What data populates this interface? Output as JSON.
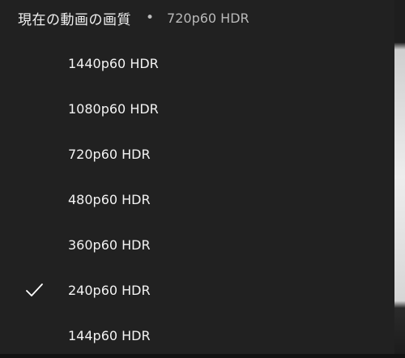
{
  "header": {
    "title": "現在の動画の画質",
    "separator": "•",
    "current_quality": "720p60 HDR"
  },
  "quality_options": [
    {
      "label": "1440p60 HDR",
      "selected": false
    },
    {
      "label": "1080p60 HDR",
      "selected": false
    },
    {
      "label": "720p60 HDR",
      "selected": false
    },
    {
      "label": "480p60 HDR",
      "selected": false
    },
    {
      "label": "360p60 HDR",
      "selected": false
    },
    {
      "label": "240p60 HDR",
      "selected": true
    },
    {
      "label": "144p60 HDR",
      "selected": false
    }
  ],
  "icons": {
    "selected": "check-icon"
  },
  "colors": {
    "menu_background": "#212121",
    "text": "#ffffff",
    "secondary_text": "#b9b9b9"
  }
}
